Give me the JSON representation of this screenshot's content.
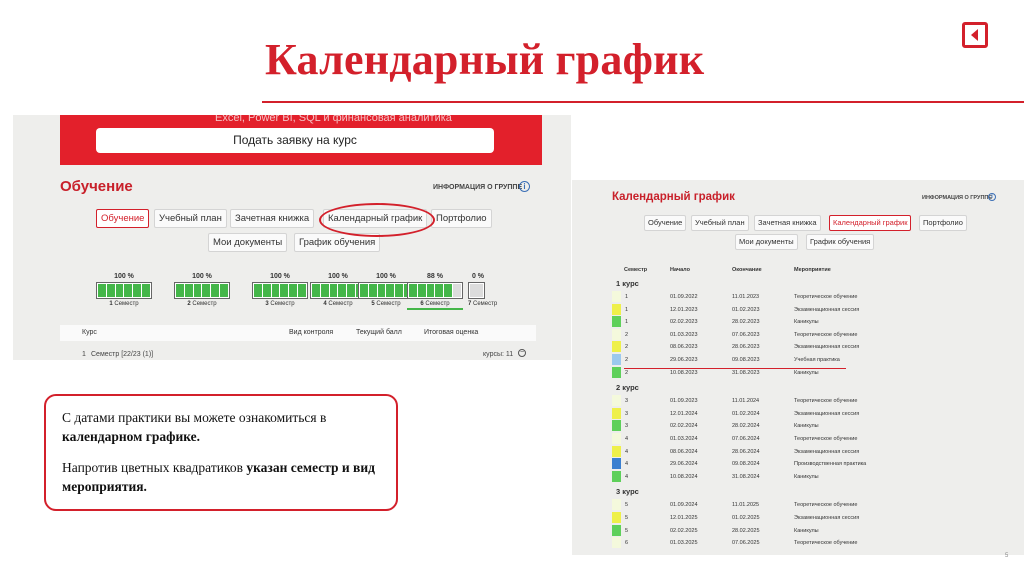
{
  "slide": {
    "title": "Календарный график",
    "page_number": "5"
  },
  "left_shot": {
    "banner_text": "Excel, Power BI, SQL и финансовая аналитика",
    "apply_button": "Подать заявку на курс",
    "section_title": "Обучение",
    "group_info": "ИНФОРМАЦИЯ О ГРУППЕ",
    "tabs": [
      "Обучение",
      "Учебный план",
      "Зачетная книжка",
      "Календарный график",
      "Портфолио",
      "Мои документы",
      "График обучения"
    ],
    "semesters": [
      {
        "pct": "100 %",
        "num": "1",
        "label": "Семестр",
        "fill": 1.0
      },
      {
        "pct": "100 %",
        "num": "2",
        "label": "Семестр",
        "fill": 1.0
      },
      {
        "pct": "100 %",
        "num": "3",
        "label": "Семестр",
        "fill": 1.0
      },
      {
        "pct": "100 %",
        "num": "4",
        "label": "Семестр",
        "fill": 1.0
      },
      {
        "pct": "100 %",
        "num": "5",
        "label": "Семестр",
        "fill": 1.0
      },
      {
        "pct": "88 %",
        "num": "6",
        "label": "Семестр",
        "fill": 0.88
      },
      {
        "pct": "0 %",
        "num": "7",
        "label": "Семестр",
        "fill": 0.0
      }
    ],
    "table_headers": [
      "Курс",
      "Вид контроля",
      "Текущий балл",
      "Итоговая оценка"
    ],
    "table_row": {
      "num": "1",
      "text": "Семестр [22/23 (1)]",
      "right": "курсы: 11"
    }
  },
  "note": {
    "p1_plain": "С датами практики вы можете ознакомиться в ",
    "p1_bold": "календарном графике.",
    "p2_plain": "Напротив цветных квадратиков ",
    "p2_bold": "указан семестр и вид мероприятия."
  },
  "right_shot": {
    "title": "Календарный график",
    "group_info": "ИНФОРМАЦИЯ О ГРУППЕ",
    "tabs": [
      "Обучение",
      "Учебный план",
      "Зачетная книжка",
      "Календарный график",
      "Портфолио",
      "Мои документы",
      "График обучения"
    ],
    "headers": [
      "Семестр",
      "Начало",
      "Окончание",
      "Мероприятие"
    ],
    "colors": {
      "theory": "#f4f9dc",
      "exam": "#eef04a",
      "holiday": "#5ed05a",
      "edu_practice": "#9cc9ee",
      "prod_practice": "#3a7fd0"
    },
    "courses": [
      {
        "label": "1 курс",
        "rows": [
          {
            "sem": "1",
            "start": "01.09.2022",
            "end": "11.01.2023",
            "event": "Теоретическое обучение",
            "kind": "theory"
          },
          {
            "sem": "1",
            "start": "12.01.2023",
            "end": "01.02.2023",
            "event": "Экзаменационная сессия",
            "kind": "exam"
          },
          {
            "sem": "1",
            "start": "02.02.2023",
            "end": "28.02.2023",
            "event": "Каникулы",
            "kind": "holiday"
          },
          {
            "sem": "2",
            "start": "01.03.2023",
            "end": "07.06.2023",
            "event": "Теоретическое обучение",
            "kind": "theory"
          },
          {
            "sem": "2",
            "start": "08.06.2023",
            "end": "28.06.2023",
            "event": "Экзаменационная сессия",
            "kind": "exam"
          },
          {
            "sem": "2",
            "start": "29.06.2023",
            "end": "09.08.2023",
            "event": "Учебная практика",
            "kind": "edu_practice"
          },
          {
            "sem": "2",
            "start": "10.08.2023",
            "end": "31.08.2023",
            "event": "Каникулы",
            "kind": "holiday"
          }
        ]
      },
      {
        "label": "2 курс",
        "rows": [
          {
            "sem": "3",
            "start": "01.09.2023",
            "end": "11.01.2024",
            "event": "Теоретическое обучение",
            "kind": "theory"
          },
          {
            "sem": "3",
            "start": "12.01.2024",
            "end": "01.02.2024",
            "event": "Экзаменационная сессия",
            "kind": "exam"
          },
          {
            "sem": "3",
            "start": "02.02.2024",
            "end": "28.02.2024",
            "event": "Каникулы",
            "kind": "holiday"
          },
          {
            "sem": "4",
            "start": "01.03.2024",
            "end": "07.06.2024",
            "event": "Теоретическое обучение",
            "kind": "theory"
          },
          {
            "sem": "4",
            "start": "08.06.2024",
            "end": "28.06.2024",
            "event": "Экзаменационная сессия",
            "kind": "exam"
          },
          {
            "sem": "4",
            "start": "29.06.2024",
            "end": "09.08.2024",
            "event": "Производственная практика",
            "kind": "prod_practice"
          },
          {
            "sem": "4",
            "start": "10.08.2024",
            "end": "31.08.2024",
            "event": "Каникулы",
            "kind": "holiday"
          }
        ]
      },
      {
        "label": "3 курс",
        "rows": [
          {
            "sem": "5",
            "start": "01.09.2024",
            "end": "11.01.2025",
            "event": "Теоретическое обучение",
            "kind": "theory"
          },
          {
            "sem": "5",
            "start": "12.01.2025",
            "end": "01.02.2025",
            "event": "Экзаменационная сессия",
            "kind": "exam"
          },
          {
            "sem": "5",
            "start": "02.02.2025",
            "end": "28.02.2025",
            "event": "Каникулы",
            "kind": "holiday"
          },
          {
            "sem": "6",
            "start": "01.03.2025",
            "end": "07.06.2025",
            "event": "Теоретическое обучение",
            "kind": "theory"
          }
        ]
      }
    ]
  }
}
